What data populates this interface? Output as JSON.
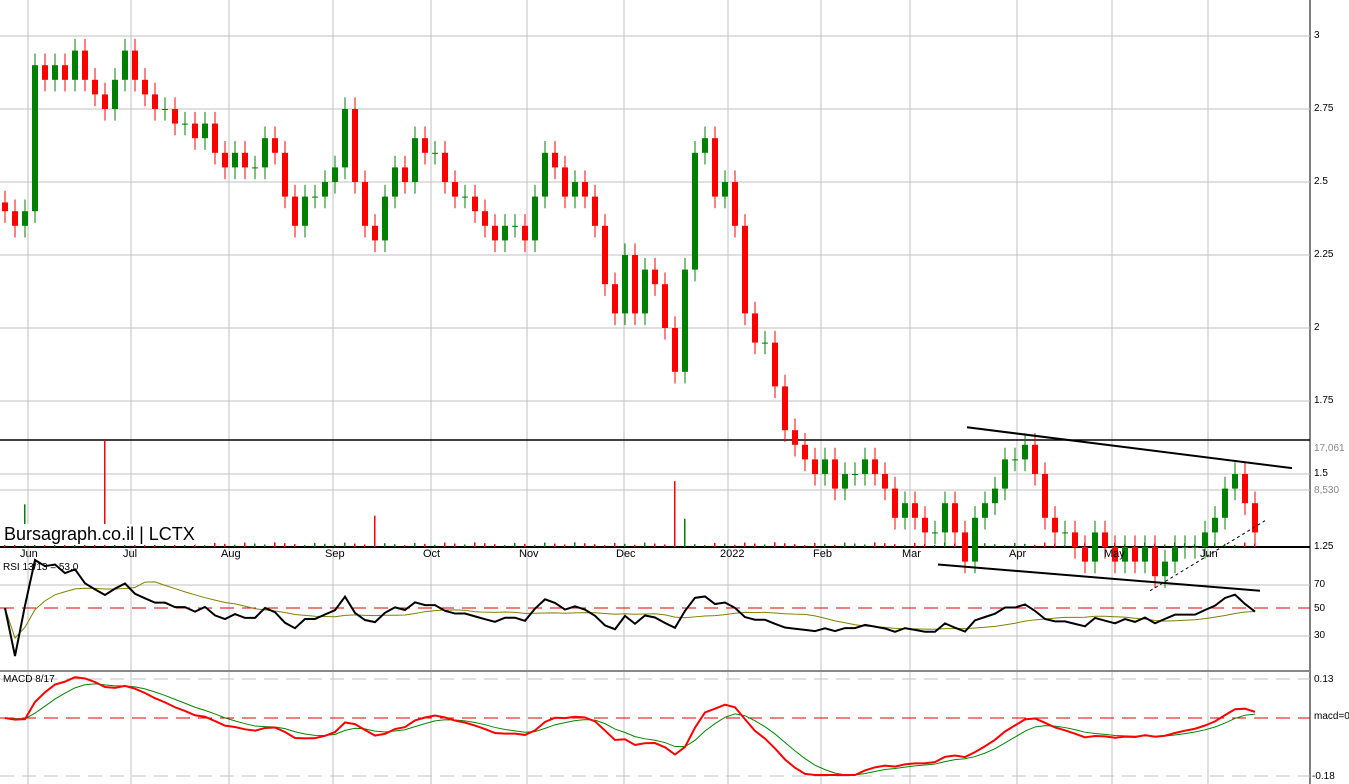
{
  "chart_data": {
    "type": "candlestick",
    "title": "Bursagraph.co.il | LCTX",
    "brand": "Bursagraph.co.il | LCTX",
    "price_axis": {
      "ticks": [
        "3",
        "2.75",
        "2.5",
        "2.25",
        "2",
        "1.75",
        "1.5",
        "1.25"
      ],
      "values": [
        3,
        2.75,
        2.5,
        2.25,
        2,
        1.75,
        1.5,
        1.25
      ]
    },
    "volume_axis": {
      "ticks": [
        "17,061",
        "8,530"
      ]
    },
    "months": [
      {
        "label": "Jun",
        "i": 2.3
      },
      {
        "label": "Jul",
        "i": 12.6
      },
      {
        "label": "Aug",
        "i": 22.4
      },
      {
        "label": "Sep",
        "i": 32.8
      },
      {
        "label": "Oct",
        "i": 42.6
      },
      {
        "label": "Nov",
        "i": 52.2
      },
      {
        "label": "Dec",
        "i": 61.9
      },
      {
        "label": "2022",
        "i": 72.3
      },
      {
        "label": "Feb",
        "i": 81.6
      },
      {
        "label": "Mar",
        "i": 90.5
      },
      {
        "label": "Apr",
        "i": 101.2
      },
      {
        "label": "May",
        "i": 110.7
      },
      {
        "label": "Jun",
        "i": 120.3
      }
    ],
    "closes": [
      2.4,
      2.35,
      2.4,
      2.9,
      2.85,
      2.9,
      2.85,
      2.95,
      2.85,
      2.8,
      2.75,
      2.85,
      2.95,
      2.85,
      2.8,
      2.75,
      2.75,
      2.7,
      2.7,
      2.65,
      2.7,
      2.6,
      2.55,
      2.6,
      2.55,
      2.55,
      2.65,
      2.6,
      2.45,
      2.35,
      2.45,
      2.45,
      2.5,
      2.55,
      2.75,
      2.5,
      2.35,
      2.3,
      2.45,
      2.55,
      2.5,
      2.65,
      2.6,
      2.6,
      2.5,
      2.45,
      2.45,
      2.4,
      2.35,
      2.3,
      2.35,
      2.35,
      2.3,
      2.45,
      2.6,
      2.55,
      2.45,
      2.5,
      2.45,
      2.35,
      2.15,
      2.05,
      2.25,
      2.05,
      2.2,
      2.15,
      2.0,
      1.85,
      2.2,
      2.6,
      2.65,
      2.45,
      2.5,
      2.35,
      2.05,
      1.95,
      1.95,
      1.8,
      1.65,
      1.6,
      1.55,
      1.5,
      1.55,
      1.45,
      1.5,
      1.5,
      1.55,
      1.5,
      1.45,
      1.35,
      1.4,
      1.35,
      1.3,
      1.3,
      1.4,
      1.3,
      1.2,
      1.35,
      1.4,
      1.45,
      1.55,
      1.55,
      1.6,
      1.5,
      1.35,
      1.3,
      1.3,
      1.25,
      1.2,
      1.3,
      1.25,
      1.2,
      1.25,
      1.2,
      1.25,
      1.15,
      1.2,
      1.25,
      1.25,
      1.25,
      1.3,
      1.35,
      1.45,
      1.5,
      1.4,
      1.3
    ],
    "volume_base": 500,
    "volume_spikes": [
      [
        2,
        6800
      ],
      [
        10,
        17061
      ],
      [
        37,
        5000
      ],
      [
        67,
        10500
      ],
      [
        68,
        4500
      ]
    ],
    "trendlines": [
      {
        "from": [
          96.2,
          1.66
        ],
        "to": [
          128.7,
          1.52
        ],
        "style": "solid"
      },
      {
        "from": [
          93.3,
          1.19
        ],
        "to": [
          125.5,
          1.1
        ],
        "style": "solid"
      },
      {
        "from": [
          114.5,
          1.1
        ],
        "to": [
          126,
          1.34
        ],
        "style": "dashed"
      }
    ],
    "rsi": {
      "label": "RSI 13/13 = 53.0",
      "ticks": [
        "70",
        "50",
        "30"
      ]
    },
    "macd": {
      "label": "MACD 8/17",
      "ticks": [
        "0.13",
        "macd=0",
        "-0.18"
      ]
    },
    "colors": {
      "up": "#008000",
      "down": "#ff0000",
      "grid": "#c0c0c0",
      "signal": "#808000"
    }
  }
}
